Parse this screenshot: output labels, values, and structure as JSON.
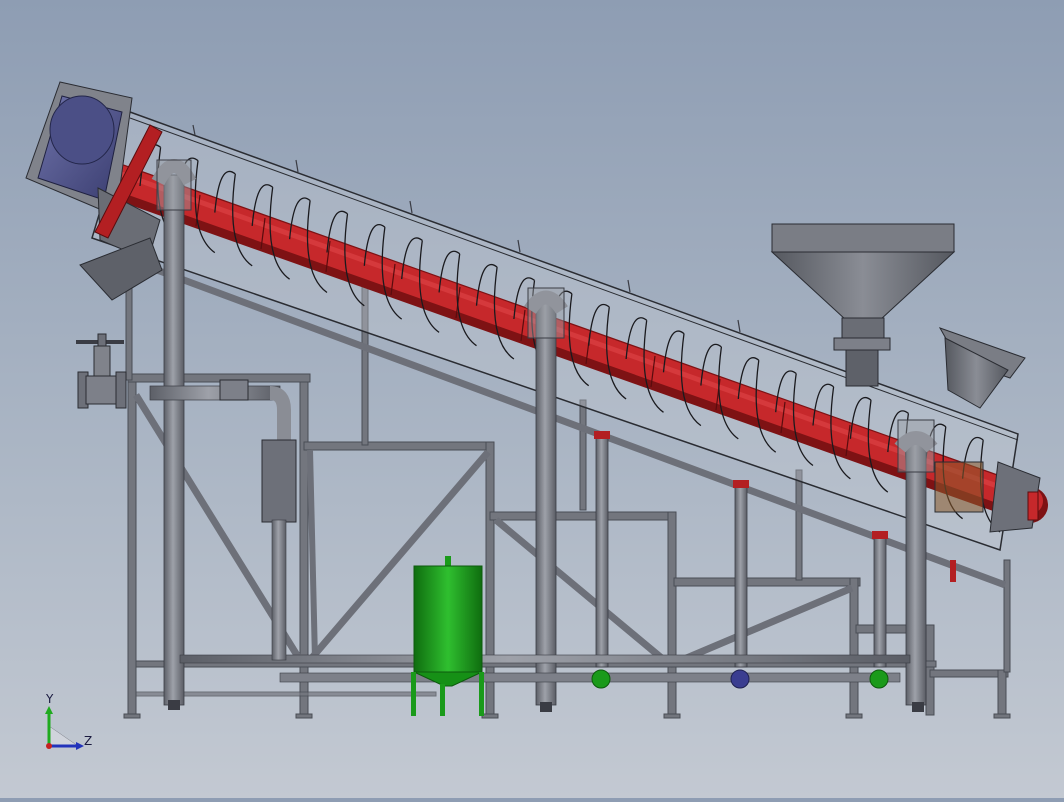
{
  "scene": {
    "colors": {
      "frame": "#6d7079",
      "frame_dark": "#4a4d55",
      "screw": "#b31f22",
      "screw_dark": "#7e1214",
      "trough": "#b5bac4",
      "motor": "#4b4f86",
      "tank": "#1a9a1a",
      "hopper": "#6a6d75",
      "pipe": "#7d8089"
    }
  },
  "triad": {
    "y_label": "Y",
    "z_label": "Z",
    "y_color": "#1faa1f",
    "z_color": "#2233bb"
  }
}
